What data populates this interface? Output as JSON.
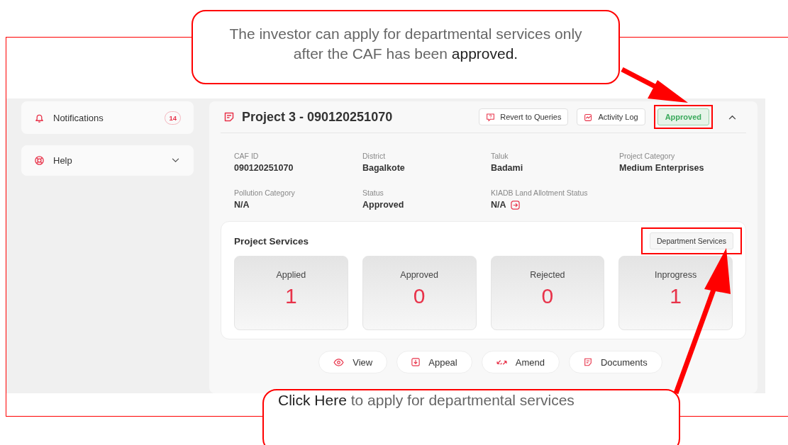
{
  "callouts": [
    {
      "text": "The investor can apply for departmental services only after the CAF has been **approved.**"
    },
    {
      "text": "**Click Here** to apply for departmental services"
    }
  ],
  "sidebar": {
    "items": [
      {
        "label": "Notifications",
        "badge": "14"
      },
      {
        "label": "Help",
        "expanded": false
      }
    ]
  },
  "project": {
    "title": "Project 3 - 090120251070",
    "expanded": true,
    "buttons": [
      {
        "label": "Revert to Queries"
      },
      {
        "label": "Activity Log"
      }
    ],
    "status_badge": {
      "label": "Approved",
      "highlighted": true
    },
    "fields": [
      {
        "label": "CAF ID",
        "value": "090120251070",
        "has_action": false
      },
      {
        "label": "District",
        "value": "Bagalkote",
        "has_action": false
      },
      {
        "label": "Taluk",
        "value": "Badami",
        "has_action": false
      },
      {
        "label": "Project Category",
        "value": "Medium Enterprises",
        "has_action": false
      },
      {
        "label": "Pollution Category",
        "value": "N/A",
        "has_action": false
      },
      {
        "label": "Status",
        "value": "Approved",
        "has_action": false
      },
      {
        "label": "KIADB Land Allotment Status",
        "value": "N/A",
        "has_action": true
      }
    ],
    "services": {
      "title": "Project Services",
      "button": {
        "label": "Department Services",
        "highlighted": true
      },
      "stats": [
        {
          "label": "Applied",
          "value": "1"
        },
        {
          "label": "Approved",
          "value": "0"
        },
        {
          "label": "Rejected",
          "value": "0"
        },
        {
          "label": "Inprogress",
          "value": "1"
        }
      ]
    },
    "actions": [
      {
        "label": "View"
      },
      {
        "label": "Appeal"
      },
      {
        "label": "Amend"
      },
      {
        "label": "Documents"
      }
    ]
  }
}
